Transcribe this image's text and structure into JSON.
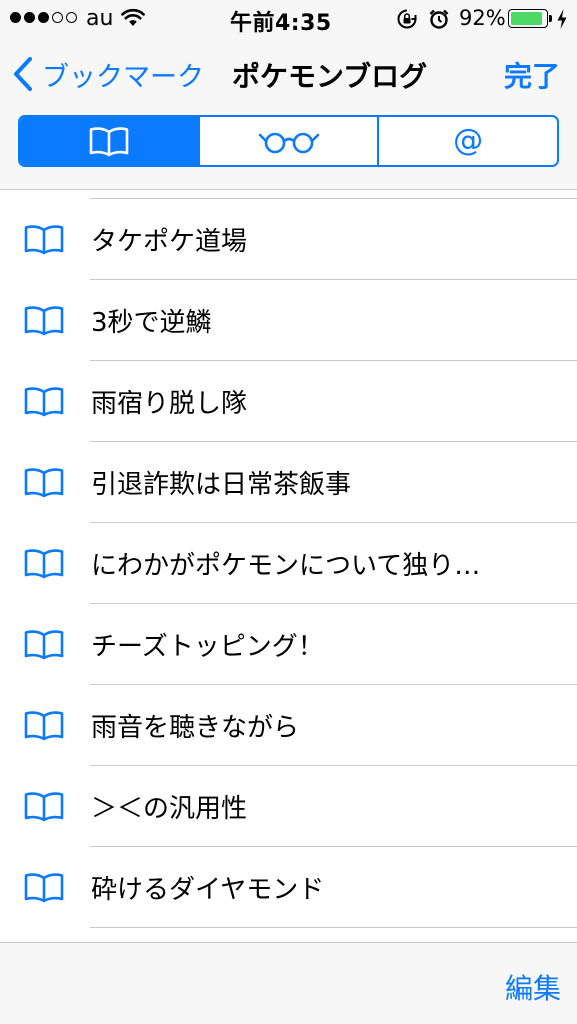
{
  "status_bar": {
    "carrier": "au",
    "time": "午前4:35",
    "battery_percent": "92%",
    "battery_level": 0.92,
    "signal_bars_filled": 3,
    "signal_bars_total": 5
  },
  "nav": {
    "back_label": "ブックマーク",
    "title": "ポケモンブログ",
    "done_label": "完了"
  },
  "segments": [
    {
      "icon": "book-icon",
      "selected": true
    },
    {
      "icon": "glasses-icon",
      "selected": false
    },
    {
      "label": "@",
      "icon": "at-icon",
      "selected": false
    }
  ],
  "bookmarks": [
    {
      "title": "タケポケ道場"
    },
    {
      "title": "3秒で逆鱗"
    },
    {
      "title": "雨宿り脱し隊"
    },
    {
      "title": "引退詐欺は日常茶飯事"
    },
    {
      "title": "にわかがポケモンについて独り…"
    },
    {
      "title": "チーズトッピング！"
    },
    {
      "title": "雨音を聴きながら"
    },
    {
      "title": "＞＜の汎用性"
    },
    {
      "title": "砕けるダイヤモンド"
    }
  ],
  "toolbar": {
    "edit_label": "編集"
  },
  "colors": {
    "accent": "#0a7aff",
    "battery": "#4cd964",
    "separator": "#c8c7cc",
    "bar_background": "#f7f7f8"
  }
}
